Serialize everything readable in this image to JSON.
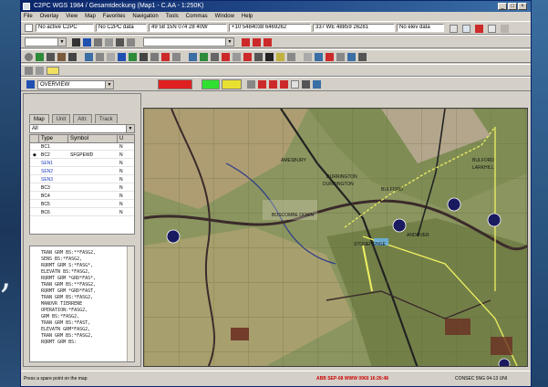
{
  "window": {
    "title": "C2PC   WGS 1984 / Gesamtdeckung  (Map1 - C.AA - 1:250K)"
  },
  "menu": {
    "items": [
      "File",
      "Overlay",
      "View",
      "Map",
      "Favorites",
      "Navigation",
      "Tools",
      "Commas",
      "Window",
      "Help"
    ]
  },
  "toolbar1": {
    "fields": [
      "No active C2PC",
      "No C2PC data",
      "49 58 15N 074 28 40W",
      "+10 5484038 6469262",
      "337 WE 48859 26281",
      "No elev data"
    ]
  },
  "left_panel": {
    "combo_value": "OVERVIEW",
    "tabs": [
      "Map",
      "Unit",
      "Attr.",
      "Track"
    ],
    "filter_value": "All",
    "columns": [
      "Type",
      "Symbol",
      "U"
    ],
    "rows": [
      {
        "type": "BC1",
        "symbol": "",
        "u": "N"
      },
      {
        "type": "BC2",
        "symbol": "SFGPEWD",
        "u": "N"
      },
      {
        "type": "SEN1",
        "symbol": "",
        "u": "N"
      },
      {
        "type": "SEN2",
        "symbol": "",
        "u": "N"
      },
      {
        "type": "SEN3",
        "symbol": "",
        "u": "N"
      },
      {
        "type": "BC3",
        "symbol": "",
        "u": "N"
      },
      {
        "type": "BC4",
        "symbol": "",
        "u": "N"
      },
      {
        "type": "BC5",
        "symbol": "",
        "u": "N"
      },
      {
        "type": "BC6",
        "symbol": "",
        "u": "N"
      }
    ],
    "text_lines": [
      "TRAN GRM BS:**FASG2,",
      "SENS BS:*FASG2,",
      "RQRMT GRM S:*FASG*,",
      "ELEVATN BS:*FASG2,",
      "RQRMT GRM *GRD*FAS*,",
      "TRAN GRM BS:**FASG2,",
      "RQRMT GRM *GRD*FAST,",
      "TRAN GRM BS:*FASG2,",
      "MANOVR TIERRENE",
      "OPERATION:*FASG2,",
      "GRM BS:*FASG2,",
      "TRAN GRM BS:*FAST,",
      "ELEVATN GRM*FASG2,",
      "TRAN GRM BS:*FASG2,",
      "RQRMT GRM BS:"
    ]
  },
  "map_toolbar": {
    "red_button": "",
    "green_button": "",
    "yellow_button": ""
  },
  "map": {
    "labels": [
      "AMESBURY",
      "DURRINGTON",
      "DURRINGTON",
      "BULFORD",
      "BULFORD",
      "LARKHILL",
      "BOSCOMBE DOWN",
      "ANDOVER",
      "STONEHENGE"
    ]
  },
  "statusbar": {
    "left_text": "Press a spare point on the map",
    "center_text": "ABB  SEP-08 WWW 0960 16:26:48",
    "right_text": "CONSEC 5NG 04-13 UNI"
  },
  "colors": {
    "title_gradient_start": "#0a246a",
    "title_gradient_end": "#3a6ea5",
    "chrome": "#d4d0c8",
    "map_base": "#8a9560"
  }
}
